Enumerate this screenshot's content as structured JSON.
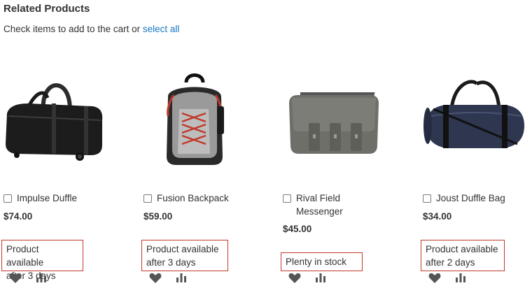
{
  "block": {
    "title": "Related Products",
    "hint_text": "Check items to add to the cart or ",
    "select_all_label": "select all"
  },
  "products": [
    {
      "name": "Impulse Duffle",
      "price": "$74.00",
      "stock_line1": "Product available",
      "stock_line2": "after 3 days",
      "image_icon": "black-rolling-duffle-image"
    },
    {
      "name": "Fusion Backpack",
      "price": "$59.00",
      "stock_line1": "Product available",
      "stock_line2": "after 3 days",
      "image_icon": "gray-red-backpack-image"
    },
    {
      "name_line1": "Rival Field",
      "name_line2": "Messenger",
      "price": "$45.00",
      "stock_line1": "Plenty in stock",
      "image_icon": "gray-messenger-bag-image"
    },
    {
      "name": "Joust Duffle Bag",
      "price": "$34.00",
      "stock_line1": "Product available",
      "stock_line2": "after 2 days",
      "image_icon": "navy-duffle-bag-image"
    }
  ],
  "actions": {
    "wishlist_icon": "heart-icon",
    "compare_icon": "bar-chart-icon"
  },
  "colors": {
    "link": "#1979c3",
    "highlight_border": "#c0392b",
    "text": "#333333",
    "icon": "#555555"
  }
}
